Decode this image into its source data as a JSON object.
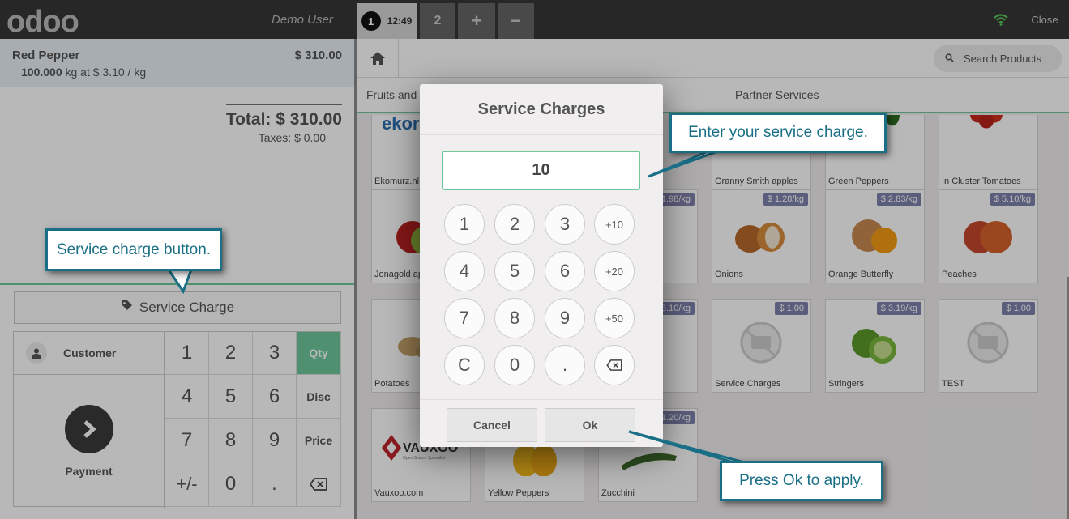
{
  "topbar": {
    "logo": "odoo",
    "user": "Demo User",
    "tabs": [
      {
        "number": "1",
        "time": "12:49"
      },
      {
        "number": "2"
      }
    ],
    "add_tab": "+",
    "remove_tab": "−",
    "close_label": "Close"
  },
  "order": {
    "line": {
      "name": "Red Pepper",
      "price": "$ 310.00",
      "qty": "100.000",
      "unit_info": "kg at $ 3.10 / kg"
    },
    "total": "Total: $ 310.00",
    "taxes": "Taxes: $ 0.00"
  },
  "actions": {
    "service_charge": "Service Charge",
    "customer": "Customer",
    "payment": "Payment"
  },
  "numpad": {
    "keys": [
      "1",
      "2",
      "3",
      "Qty",
      "4",
      "5",
      "6",
      "Disc",
      "7",
      "8",
      "9",
      "Price",
      "+/-",
      "0",
      "."
    ],
    "selected_mode": "Qty"
  },
  "search": {
    "placeholder": "Search Products"
  },
  "categories": [
    "Fruits and Vegetables",
    "Partner Services"
  ],
  "products": [
    {
      "name": "Ekomurz.nl",
      "price": "",
      "logo": "ekor"
    },
    {
      "name": "Granny Smith apples",
      "price": ""
    },
    {
      "name": "Green Peppers",
      "price": ""
    },
    {
      "name": "In Cluster Tomatoes",
      "price": ""
    },
    {
      "name": "Jonagold ap",
      "price": ""
    },
    {
      "name": "",
      "price": "1.98/kg"
    },
    {
      "name": "Onions",
      "price": "$ 1.28/kg"
    },
    {
      "name": "Orange Butterfly",
      "price": "$ 2.83/kg"
    },
    {
      "name": "Peaches",
      "price": "$ 5.10/kg"
    },
    {
      "name": "Potatoes",
      "price": ""
    },
    {
      "name": "",
      "price": "3.10/kg"
    },
    {
      "name": "Service Charges",
      "price": "$ 1.00"
    },
    {
      "name": "Stringers",
      "price": "$ 3.19/kg"
    },
    {
      "name": "TEST",
      "price": "$ 1.00"
    },
    {
      "name": "Vauxoo.com",
      "price": "",
      "logo": "VAUXOO",
      "tagline": "Open Source Specialist"
    },
    {
      "name": "Yellow Peppers",
      "price": ""
    },
    {
      "name": "Zucchini",
      "price": "1.20/kg"
    }
  ],
  "popup": {
    "title": "Service Charges",
    "value": "10",
    "keys": [
      "1",
      "2",
      "3",
      "+10",
      "4",
      "5",
      "6",
      "+20",
      "7",
      "8",
      "9",
      "+50",
      "C",
      "0",
      "."
    ],
    "cancel": "Cancel",
    "ok": "Ok"
  },
  "callouts": {
    "service_button": "Service charge button.",
    "enter_charge": "Enter your service charge.",
    "press_ok": "Press Ok to apply."
  },
  "colors": {
    "accent": "#6ec89b",
    "callout": "#1a6f86",
    "topbar": "#363636",
    "price_tag": "#7f82ac"
  }
}
